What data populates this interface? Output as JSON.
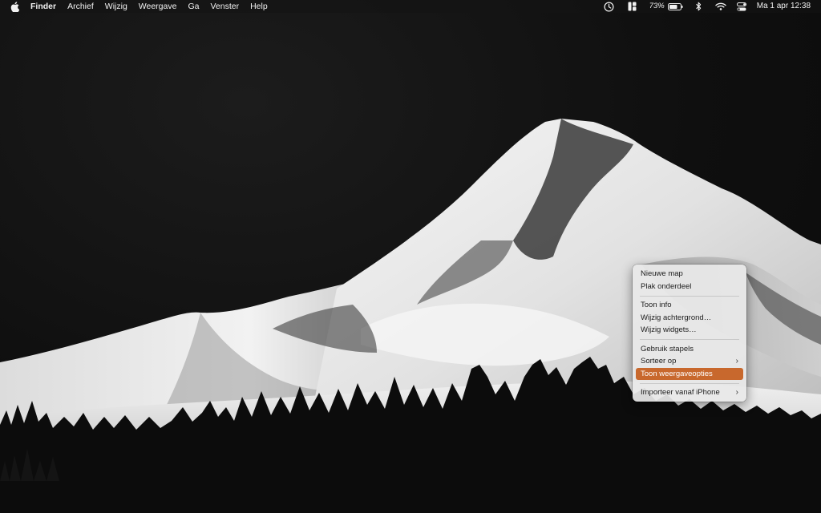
{
  "menubar": {
    "apple_icon": "apple-logo-icon",
    "app_name": "Finder",
    "menus": [
      "Archief",
      "Wijzig",
      "Weergave",
      "Ga",
      "Venster",
      "Help"
    ],
    "status_icons": [
      "screen-time-icon",
      "stage-manager-icon",
      "battery-icon",
      "bluetooth-icon",
      "wifi-icon",
      "control-center-icon"
    ],
    "battery_percent": "73%",
    "clock": "Ma 1 apr  12:38"
  },
  "context_menu": {
    "items": {
      "new_folder": "Nieuwe map",
      "paste_item": "Plak onderdeel",
      "get_info": "Toon info",
      "change_wallpaper": "Wijzig achtergrond…",
      "edit_widgets": "Wijzig widgets…",
      "use_stacks": "Gebruik stapels",
      "sort_by": "Sorteer op",
      "show_view_options": "Toon weergaveopties",
      "import_from_iphone": "Importeer vanaf iPhone"
    },
    "highlighted": "show_view_options",
    "highlight_color": "#c8682d"
  },
  "wallpaper": {
    "description_icon": "mountain-wallpaper"
  }
}
